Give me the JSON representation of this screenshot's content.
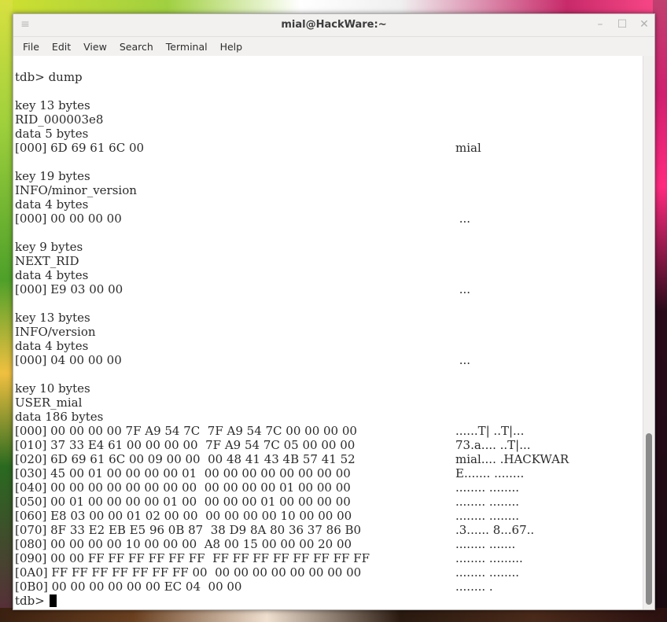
{
  "window": {
    "title": "mial@HackWare:~",
    "controls": {
      "menu_icon": "≡",
      "minimize": "–",
      "maximize": "☐",
      "close": "✕"
    }
  },
  "menubar": [
    "File",
    "Edit",
    "View",
    "Search",
    "Terminal",
    "Help"
  ],
  "terminal": {
    "lines": [
      {
        "text": "tdb> dump",
        "ascii": ""
      },
      {
        "text": "",
        "ascii": ""
      },
      {
        "text": "key 13 bytes",
        "ascii": ""
      },
      {
        "text": "RID_000003e8",
        "ascii": ""
      },
      {
        "text": "data 5 bytes",
        "ascii": ""
      },
      {
        "text": "[000] 6D 69 61 6C 00",
        "ascii": "mial"
      },
      {
        "text": "",
        "ascii": ""
      },
      {
        "text": "key 19 bytes",
        "ascii": ""
      },
      {
        "text": "INFO/minor_version",
        "ascii": ""
      },
      {
        "text": "data 4 bytes",
        "ascii": ""
      },
      {
        "text": "[000] 00 00 00 00",
        "ascii": " ..."
      },
      {
        "text": "",
        "ascii": ""
      },
      {
        "text": "key 9 bytes",
        "ascii": ""
      },
      {
        "text": "NEXT_RID",
        "ascii": ""
      },
      {
        "text": "data 4 bytes",
        "ascii": ""
      },
      {
        "text": "[000] E9 03 00 00",
        "ascii": " ..."
      },
      {
        "text": "",
        "ascii": ""
      },
      {
        "text": "key 13 bytes",
        "ascii": ""
      },
      {
        "text": "INFO/version",
        "ascii": ""
      },
      {
        "text": "data 4 bytes",
        "ascii": ""
      },
      {
        "text": "[000] 04 00 00 00",
        "ascii": " ..."
      },
      {
        "text": "",
        "ascii": ""
      },
      {
        "text": "key 10 bytes",
        "ascii": ""
      },
      {
        "text": "USER_mial",
        "ascii": ""
      },
      {
        "text": "data 186 bytes",
        "ascii": ""
      },
      {
        "text": "[000] 00 00 00 00 7F A9 54 7C  7F A9 54 7C 00 00 00 00",
        "ascii": "......T| ..T|..."
      },
      {
        "text": "[010] 37 33 E4 61 00 00 00 00  7F A9 54 7C 05 00 00 00",
        "ascii": "73.a.... ..T|..."
      },
      {
        "text": "[020] 6D 69 61 6C 00 09 00 00  00 48 41 43 4B 57 41 52",
        "ascii": "mial.... .HACKWAR"
      },
      {
        "text": "[030] 45 00 01 00 00 00 00 01  00 00 00 00 00 00 00 00",
        "ascii": "E....... ........"
      },
      {
        "text": "[040] 00 00 00 00 00 00 00 00  00 00 00 00 01 00 00 00",
        "ascii": "........ ........"
      },
      {
        "text": "[050] 00 01 00 00 00 00 01 00  00 00 00 01 00 00 00 00",
        "ascii": "........ ........"
      },
      {
        "text": "[060] E8 03 00 00 01 02 00 00  00 00 00 00 10 00 00 00",
        "ascii": "........ ........"
      },
      {
        "text": "[070] 8F 33 E2 EB E5 96 0B 87  38 D9 8A 80 36 37 86 B0",
        "ascii": ".3...... 8...67.."
      },
      {
        "text": "[080] 00 00 00 00 10 00 00 00  A8 00 15 00 00 00 20 00",
        "ascii": "........ ......."
      },
      {
        "text": "[090] 00 00 FF FF FF FF FF FF  FF FF FF FF FF FF FF FF",
        "ascii": "........ ........."
      },
      {
        "text": "[0A0] FF FF FF FF FF FF FF 00  00 00 00 00 00 00 00 00",
        "ascii": "........ ........"
      },
      {
        "text": "[0B0] 00 00 00 00 00 00 EC 04  00 00",
        "ascii": "........ ."
      }
    ],
    "prompt": "tdb>"
  },
  "colors": {
    "terminal_bg": "#ffffff",
    "terminal_fg": "#2a2a2a",
    "titlebar_bg": "#f2f1f0"
  }
}
